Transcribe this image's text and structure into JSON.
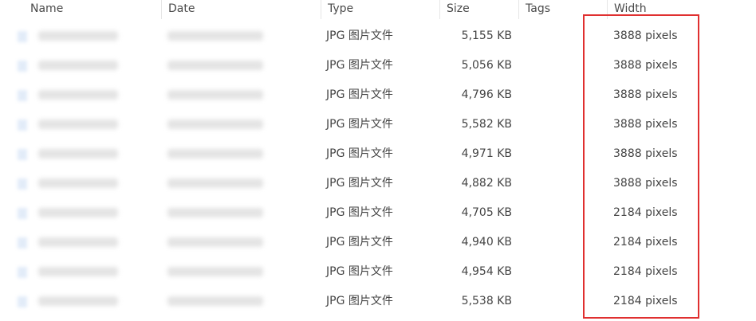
{
  "columns": {
    "name": "Name",
    "date": "Date",
    "type": "Type",
    "size": "Size",
    "tags": "Tags",
    "width": "Width"
  },
  "rows": [
    {
      "type": "JPG 图片文件",
      "size": "5,155 KB",
      "width": "3888 pixels"
    },
    {
      "type": "JPG 图片文件",
      "size": "5,056 KB",
      "width": "3888 pixels"
    },
    {
      "type": "JPG 图片文件",
      "size": "4,796 KB",
      "width": "3888 pixels"
    },
    {
      "type": "JPG 图片文件",
      "size": "5,582 KB",
      "width": "3888 pixels"
    },
    {
      "type": "JPG 图片文件",
      "size": "4,971 KB",
      "width": "3888 pixels"
    },
    {
      "type": "JPG 图片文件",
      "size": "4,882 KB",
      "width": "3888 pixels"
    },
    {
      "type": "JPG 图片文件",
      "size": "4,705 KB",
      "width": "2184 pixels"
    },
    {
      "type": "JPG 图片文件",
      "size": "4,940 KB",
      "width": "2184 pixels"
    },
    {
      "type": "JPG 图片文件",
      "size": "4,954 KB",
      "width": "2184 pixels"
    },
    {
      "type": "JPG 图片文件",
      "size": "5,538 KB",
      "width": "2184 pixels"
    }
  ],
  "icons": {
    "file": "image-file-icon"
  },
  "colors": {
    "highlight": "#e03030"
  }
}
